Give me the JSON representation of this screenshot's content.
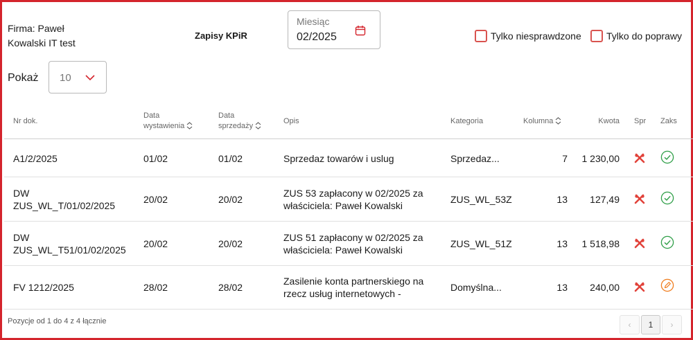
{
  "header": {
    "firma_line1": "Firma: Paweł",
    "firma_line2": "Kowalski IT test",
    "title": "Zapisy KPiR",
    "month_label": "Miesiąc",
    "month_value": "02/2025",
    "checkbox_unchecked_label": "Tylko niesprawdzone",
    "checkbox_correction_label": "Tylko do poprawy"
  },
  "show": {
    "label": "Pokaż",
    "value": "10"
  },
  "columns": {
    "nr": "Nr dok.",
    "data_wyst_1": "Data",
    "data_wyst_2": "wystawienia",
    "data_sprz_1": "Data",
    "data_sprz_2": "sprzedaży",
    "opis": "Opis",
    "kategoria": "Kategoria",
    "kolumna": "Kolumna",
    "kwota": "Kwota",
    "spr": "Spr",
    "zaks": "Zaks"
  },
  "rows": [
    {
      "nr1": "A1/2/2025",
      "nr2": "",
      "data_wyst": "01/02",
      "data_sprz": "01/02",
      "opis1": "Sprzedaz towarów i uslug",
      "opis2": "",
      "kategoria": "Sprzedaz...",
      "kolumna": "7",
      "kwota": "1 230,00",
      "spr_icon": "wrench-cross-icon",
      "zaks_icon": "check-circle-icon"
    },
    {
      "nr1": "DW",
      "nr2": "ZUS_WL_T/01/02/2025",
      "data_wyst": "20/02",
      "data_sprz": "20/02",
      "opis1": "ZUS 53 zapłacony w 02/2025 za",
      "opis2": "właściciela: Paweł Kowalski",
      "kategoria": "ZUS_WL_53Z",
      "kolumna": "13",
      "kwota": "127,49",
      "spr_icon": "wrench-cross-icon",
      "zaks_icon": "check-circle-icon"
    },
    {
      "nr1": "DW",
      "nr2": "ZUS_WL_T51/01/02/2025",
      "data_wyst": "20/02",
      "data_sprz": "20/02",
      "opis1": "ZUS 51 zapłacony w 02/2025 za",
      "opis2": "właściciela: Paweł Kowalski",
      "kategoria": "ZUS_WL_51Z",
      "kolumna": "13",
      "kwota": "1 518,98",
      "spr_icon": "wrench-cross-icon",
      "zaks_icon": "check-circle-icon"
    },
    {
      "nr1": "FV 1212/2025",
      "nr2": "",
      "data_wyst": "28/02",
      "data_sprz": "28/02",
      "opis1": "Zasilenie konta partnerskiego na",
      "opis2": "rzecz usług internetowych -",
      "kategoria": "Domyślna...",
      "kolumna": "13",
      "kwota": "240,00",
      "spr_icon": "wrench-cross-icon",
      "zaks_icon": "edit-circle-icon"
    }
  ],
  "footer": {
    "summary": "Pozycje od 1 do 4 z 4 łącznie",
    "prev": "‹",
    "page": "1",
    "next": "›"
  },
  "colors": {
    "accent": "#d4242c",
    "check_green": "#2e9e47",
    "edit_orange": "#ef7d1e"
  }
}
